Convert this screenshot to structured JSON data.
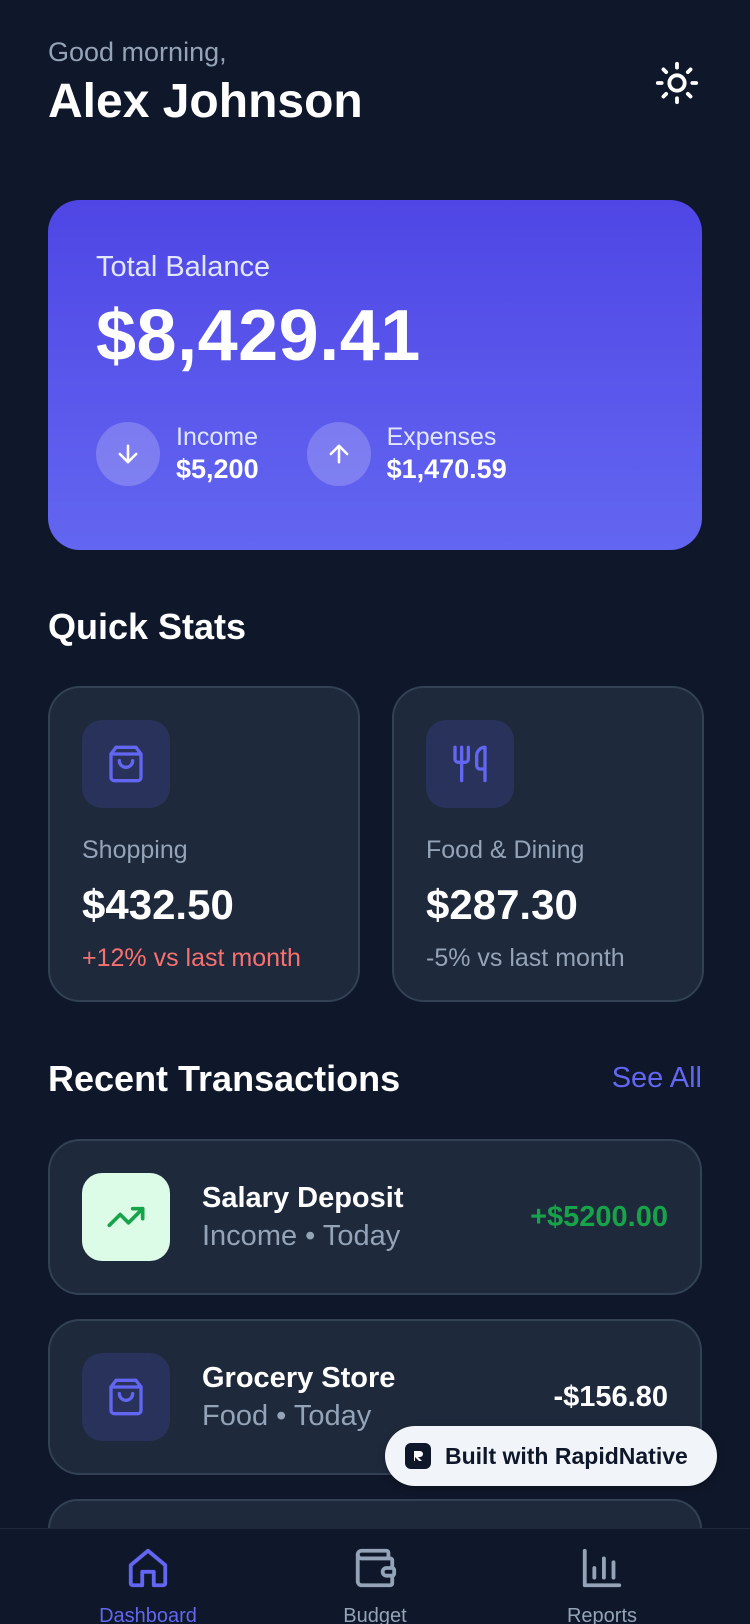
{
  "header": {
    "greeting": "Good morning,",
    "user_name": "Alex Johnson",
    "theme_icon": "sun-icon"
  },
  "balance": {
    "label": "Total Balance",
    "amount": "$8,429.41",
    "income": {
      "label": "Income",
      "value": "$5,200",
      "icon": "arrow-down-icon"
    },
    "expenses": {
      "label": "Expenses",
      "value": "$1,470.59",
      "icon": "arrow-up-icon"
    },
    "gradient": [
      "#4f46e5",
      "#6366f1"
    ]
  },
  "quick_stats": {
    "title": "Quick Stats",
    "items": [
      {
        "icon": "shopping-bag-icon",
        "label": "Shopping",
        "value": "$432.50",
        "change": "+12% vs last month",
        "change_color": "#f87171"
      },
      {
        "icon": "utensils-icon",
        "label": "Food & Dining",
        "value": "$287.30",
        "change": "-5% vs last month",
        "change_color": "#94a3b8"
      }
    ]
  },
  "transactions": {
    "title": "Recent Transactions",
    "see_all": "See All",
    "items": [
      {
        "icon": "trending-up-icon",
        "name": "Salary Deposit",
        "meta": "Income • Today",
        "amount": "+$5200.00",
        "amount_color": "#16a34a"
      },
      {
        "icon": "shopping-bag-icon",
        "name": "Grocery Store",
        "meta": "Food • Today",
        "amount": "-$156.80",
        "amount_color": "#ffffff"
      }
    ]
  },
  "badge": {
    "text": "Built with RapidNative"
  },
  "tabs": [
    {
      "label": "Dashboard",
      "icon": "home-icon",
      "active": true
    },
    {
      "label": "Budget",
      "icon": "wallet-icon",
      "active": false
    },
    {
      "label": "Reports",
      "icon": "bar-chart-icon",
      "active": false
    }
  ],
  "colors": {
    "background": "#0f172a",
    "card": "#1e293b",
    "accent": "#6366f1",
    "muted": "#94a3b8",
    "income": "#16a34a",
    "expense_alert": "#f87171"
  }
}
